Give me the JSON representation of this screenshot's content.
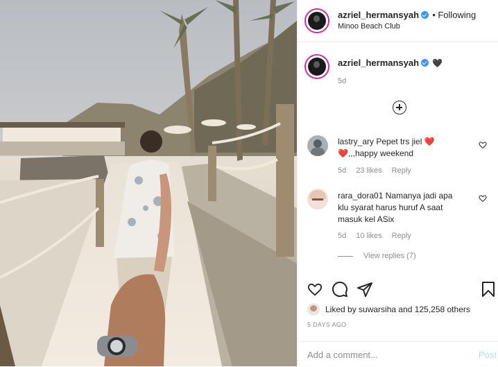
{
  "post": {
    "username": "azriel_hermansyah",
    "follow_state": "Following",
    "location": "Minoo Beach Club",
    "caption": {
      "username": "azriel_hermansyah",
      "emoji": "🖤",
      "time": "5d"
    },
    "load_more_icon": "plus-circle-icon",
    "comments": [
      {
        "username": "lastry_ary",
        "text_line1": "Pepet trs jiel",
        "emoji1": "❤️",
        "emoji2": "❤️",
        "text_line2": ",,,happy weekend",
        "time": "5d",
        "likes": "23 likes",
        "reply": "Reply"
      },
      {
        "username": "rara_dora01",
        "text_line1": "Namanya jadi apa",
        "text_line2": "klu syarat harus huruf A saat",
        "text_line3": "masuk kel ASix",
        "time": "5d",
        "likes": "10 likes",
        "reply": "Reply",
        "view_replies": "View replies (7)"
      }
    ],
    "liked_by": {
      "prefix": "Liked by",
      "user": "suwarsiha",
      "and": "and",
      "count": "125,258 others"
    },
    "date": "5 DAYS AGO",
    "comment_placeholder": "Add a comment...",
    "post_button": "Post"
  },
  "colors": {
    "accent": "#3897f0",
    "heart": "#ed4956",
    "text": "#262626",
    "muted": "#8e8e8e"
  }
}
